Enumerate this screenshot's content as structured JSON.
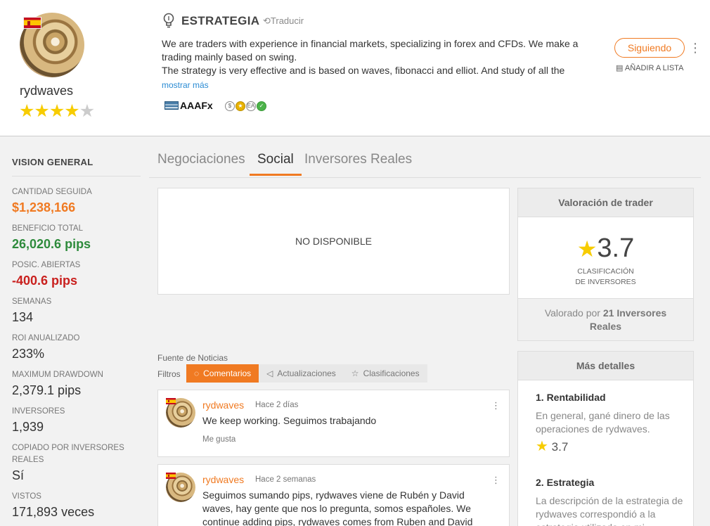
{
  "profile": {
    "username": "rydwaves",
    "rating_stars": 4,
    "rating_max": 5
  },
  "strategy": {
    "title": "ESTRATEGIA",
    "translate_label": "Traducir",
    "description_1": "We are traders with experience in financial markets, specializing in forex and CFDs. We make a trading mainly based on swing.",
    "description_2": "The strategy is very effective and is based on waves, fibonacci and elliot. And study of all the",
    "show_more": "mostrar más",
    "broker": "AAAFx",
    "badges": [
      "$",
      "★",
      "EA",
      "✓"
    ]
  },
  "actions": {
    "follow_label": "Siguiendo",
    "add_list_label": "AÑADIR A LISTA"
  },
  "overview": {
    "title": "VISION GENERAL",
    "stats": [
      {
        "label": "CANTIDAD SEGUIDA",
        "value": "$1,238,166"
      },
      {
        "label": "BENEFICIO TOTAL",
        "value": "26,020.6 pips"
      },
      {
        "label": "POSIC. ABIERTAS",
        "value": "-400.6 pips"
      },
      {
        "label": "SEMANAS",
        "value": "134"
      },
      {
        "label": "ROI ANUALIZADO",
        "value": "233%"
      },
      {
        "label": "MAXIMUM DRAWDOWN",
        "value": "2,379.1 pips"
      },
      {
        "label": "INVERSORES",
        "value": "1,939"
      },
      {
        "label": "COPIADO POR INVERSORES REALES",
        "value": "Sí"
      },
      {
        "label": "VISTOS",
        "value": "171,893 veces"
      }
    ]
  },
  "tabs": [
    {
      "label": "Negociaciones",
      "active": false
    },
    {
      "label": "Social",
      "active": true
    },
    {
      "label": "Inversores Reales",
      "active": false
    }
  ],
  "main": {
    "not_available": "NO DISPONIBLE",
    "news_title": "Fuente de Noticias",
    "filters_label": "Filtros",
    "filters": [
      {
        "label": "Comentarios",
        "active": true
      },
      {
        "label": "Actualizaciones",
        "active": false
      },
      {
        "label": "Clasificaciones",
        "active": false
      }
    ],
    "posts": [
      {
        "author": "rydwaves",
        "time": "Hace 2 días",
        "text": "We keep working. Seguimos trabajando",
        "like_label": "Me gusta"
      },
      {
        "author": "rydwaves",
        "time": "Hace 2 semanas",
        "text": "Seguimos sumando pips, rydwaves viene de Rubén y David waves, hay gente que nos lo pregunta, somos españoles. We continue adding pips, rydwaves comes from Ruben and David"
      }
    ]
  },
  "sidebar": {
    "rating_title": "Valoración de trader",
    "score": "3.7",
    "score_label_1": "CLASIFICACIÓN",
    "score_label_2": "DE INVERSORES",
    "rated_prefix": "Valorado por",
    "rated_count": "21 Inversores",
    "rated_suffix": "Reales",
    "details_title": "Más detalles",
    "details": [
      {
        "heading": "1. Rentabilidad",
        "text": "En general, gané dinero de las operaciones de rydwaves.",
        "score": "3.7"
      },
      {
        "heading": "2. Estrategia",
        "text": "La descripción de la estrategia de rydwaves correspondió a la estrategia utilizada en mi"
      }
    ]
  },
  "colors": {
    "accent": "#f07a22",
    "profit": "#2e8b3c",
    "loss": "#c9201e",
    "star": "#f7cc00"
  }
}
